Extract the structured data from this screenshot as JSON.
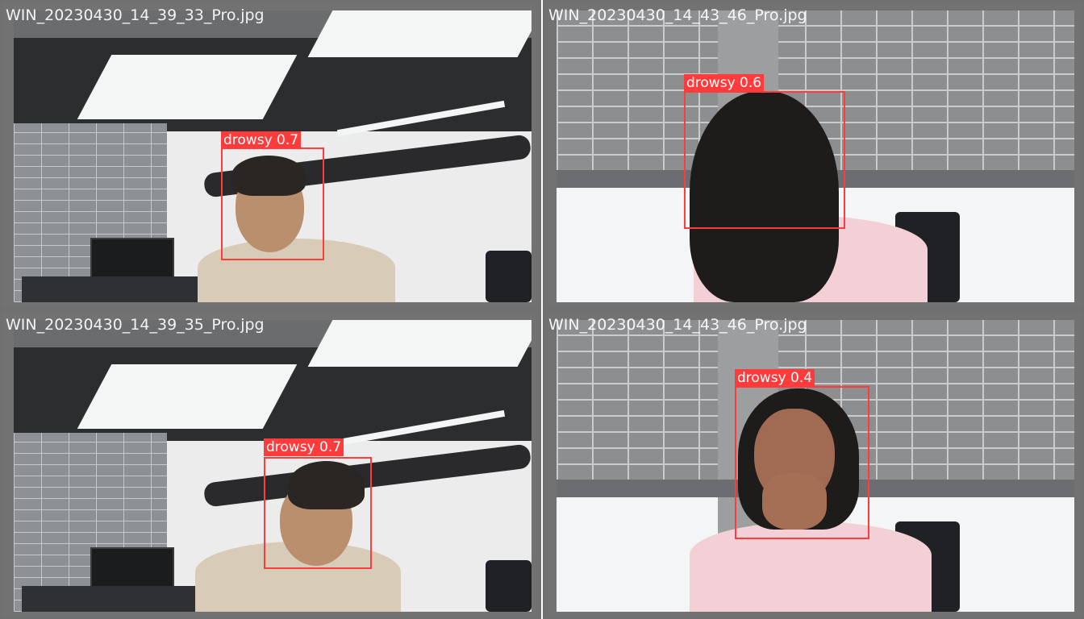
{
  "tiles": [
    {
      "filename": "WIN_20230430_14_39_33_Pro.jpg",
      "detection": {
        "label": "drowsy",
        "confidence": "0.7",
        "text": "drowsy 0.7"
      }
    },
    {
      "filename": "WIN_20230430_14_43_46_Pro.jpg",
      "detection": {
        "label": "drowsy",
        "confidence": "0.6",
        "text": "drowsy 0.6"
      }
    },
    {
      "filename": "WIN_20230430_14_39_35_Pro.jpg",
      "detection": {
        "label": "drowsy",
        "confidence": "0.7",
        "text": "drowsy 0.7"
      }
    },
    {
      "filename": "WIN_20230430_14_43_46_Pro.jpg",
      "detection": {
        "label": "drowsy",
        "confidence": "0.4",
        "text": "drowsy 0.4"
      }
    }
  ],
  "colors": {
    "box": "#ff3b3b",
    "label_text": "#ffffff",
    "tile_border": "#707070"
  }
}
